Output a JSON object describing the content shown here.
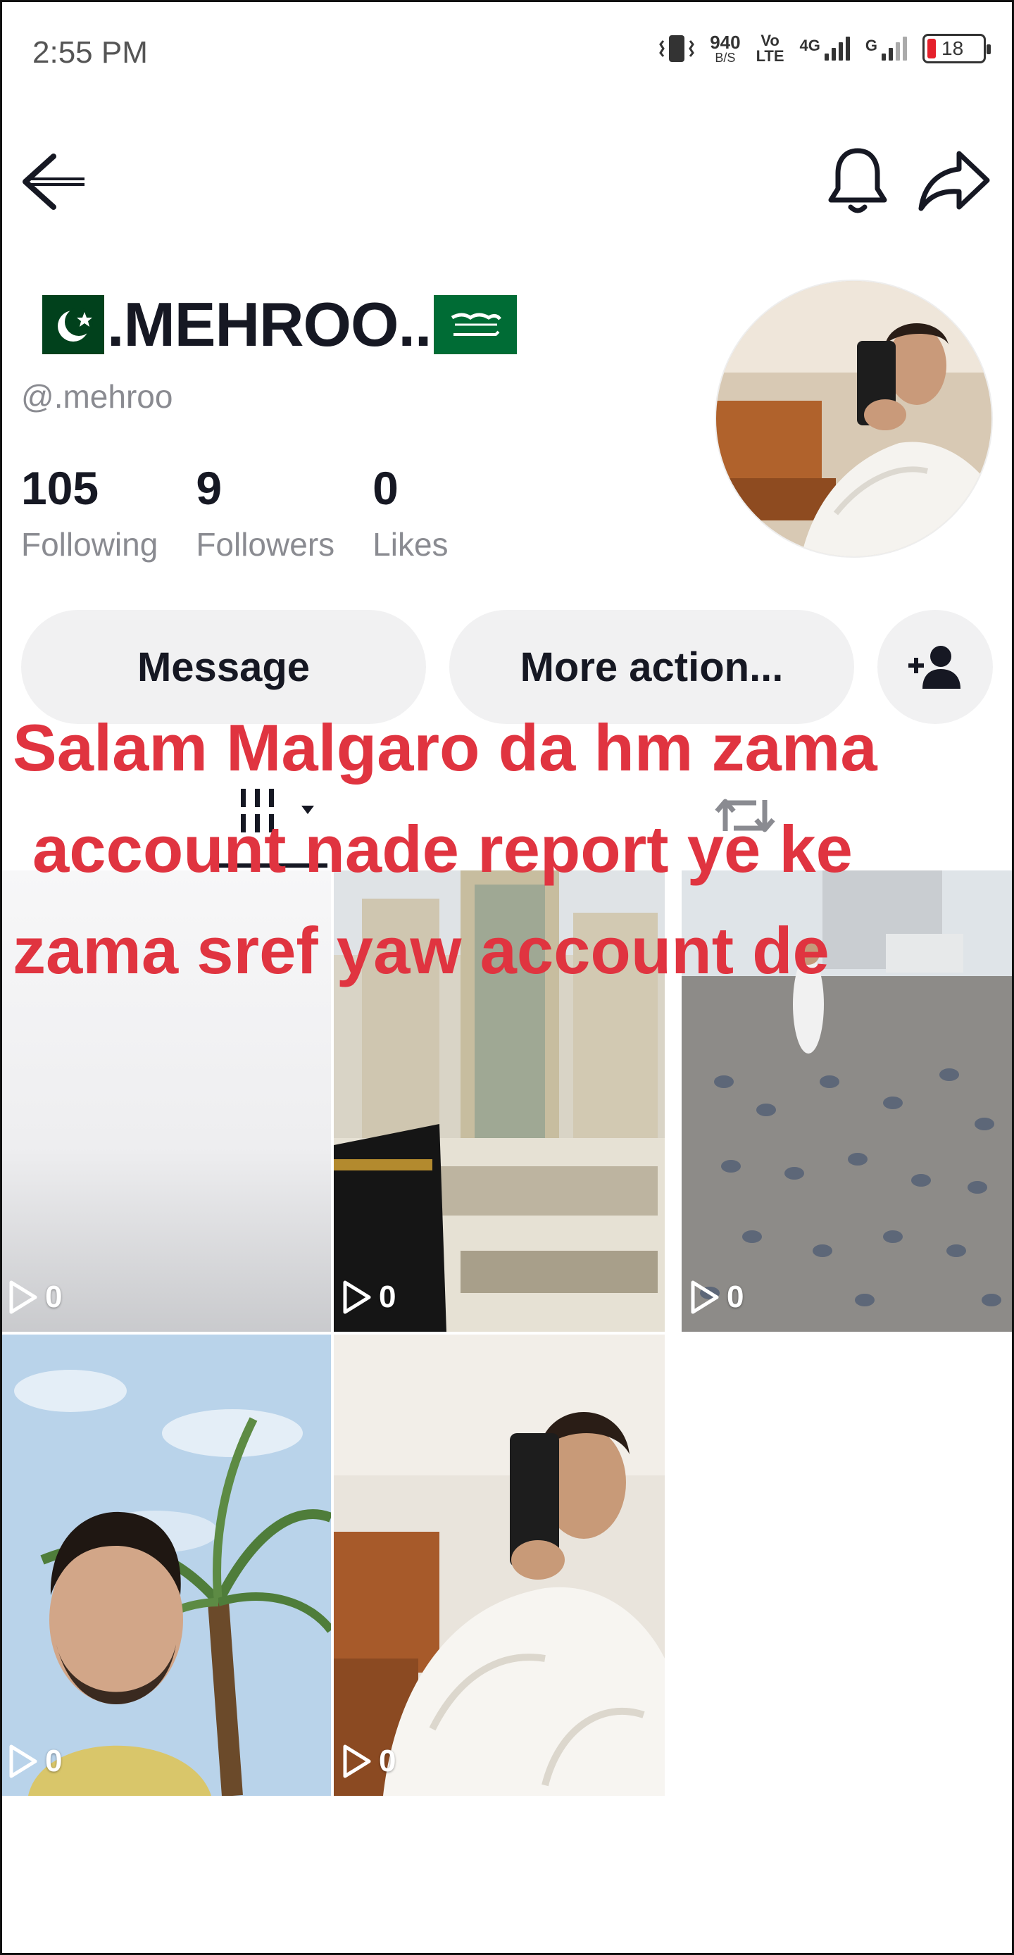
{
  "status_bar": {
    "time": "2:55 PM",
    "net_speed_value": "940",
    "net_speed_unit": "B/S",
    "volte_top": "Vo",
    "volte_bottom": "LTE",
    "network_4g": "4G",
    "network_g": "G",
    "battery_percent": "18"
  },
  "profile": {
    "display_name": ".MEHROO..",
    "username": "@.mehroo",
    "stats": [
      {
        "value": "105",
        "label": "Following"
      },
      {
        "value": "9",
        "label": "Followers"
      },
      {
        "value": "0",
        "label": "Likes"
      }
    ]
  },
  "actions": {
    "message_label": "Message",
    "more_label": "More action..."
  },
  "overlay_caption": {
    "line1": "Salam Malgaro da hm zama",
    "line2": "account nade report ye ke",
    "line3": "zama sref yaw account de"
  },
  "videos": [
    {
      "views": "0"
    },
    {
      "views": "0"
    },
    {
      "views": "0"
    },
    {
      "views": "0"
    },
    {
      "views": "0"
    }
  ],
  "colors": {
    "overlay_red": "#e03440",
    "button_bg": "#f1f1f2",
    "secondary_text": "#8a8b91"
  }
}
